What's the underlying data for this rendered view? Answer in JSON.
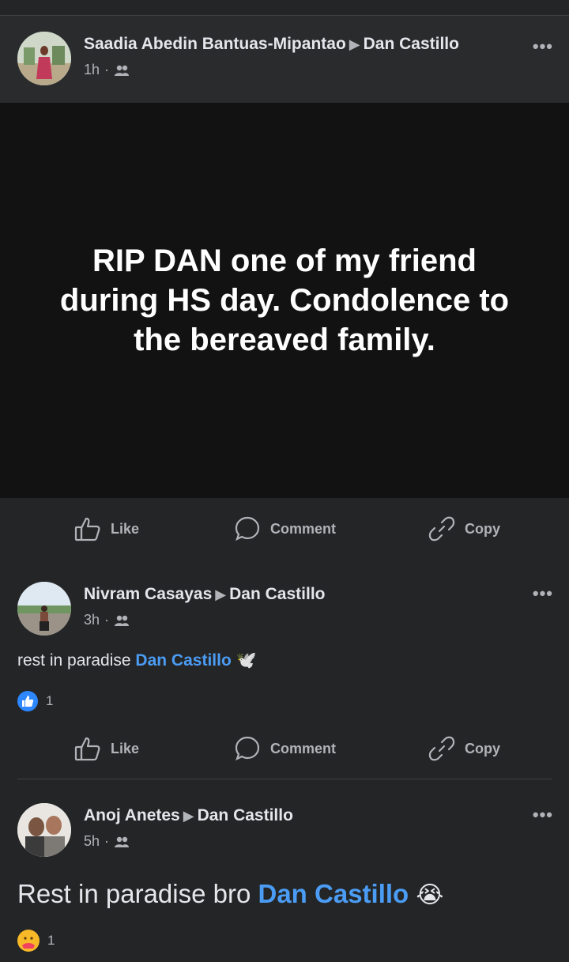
{
  "posts": [
    {
      "author": "Saadia Abedin Bantuas-Mipantao",
      "target": "Dan Castillo",
      "time": "1h",
      "status_text": "RIP DAN one of my friend during HS day. Condolence to the bereaved family.",
      "actions": {
        "like": "Like",
        "comment": "Comment",
        "copy": "Copy"
      }
    },
    {
      "author": "Nivram Casayas",
      "target": "Dan Castillo",
      "time": "3h",
      "text_before": "rest in paradise",
      "tag": "Dan Castillo",
      "emoji": "dove",
      "reaction_count": "1",
      "actions": {
        "like": "Like",
        "comment": "Comment",
        "copy": "Copy"
      }
    },
    {
      "author": "Anoj Anetes",
      "target": "Dan Castillo",
      "time": "5h",
      "text_before": "Rest in paradise bro",
      "tag": "Dan Castillo",
      "emoji": "crying-face",
      "reaction_count": "1"
    }
  ],
  "colors": {
    "background": "#242526",
    "status_background": "#121212",
    "tag": "#4b9cf5",
    "like_badge": "#2d88ff",
    "care_badge": "#f7b928"
  },
  "icons": [
    "thumbs-up-icon",
    "comment-icon",
    "link-icon",
    "friends-icon",
    "more-icon"
  ]
}
